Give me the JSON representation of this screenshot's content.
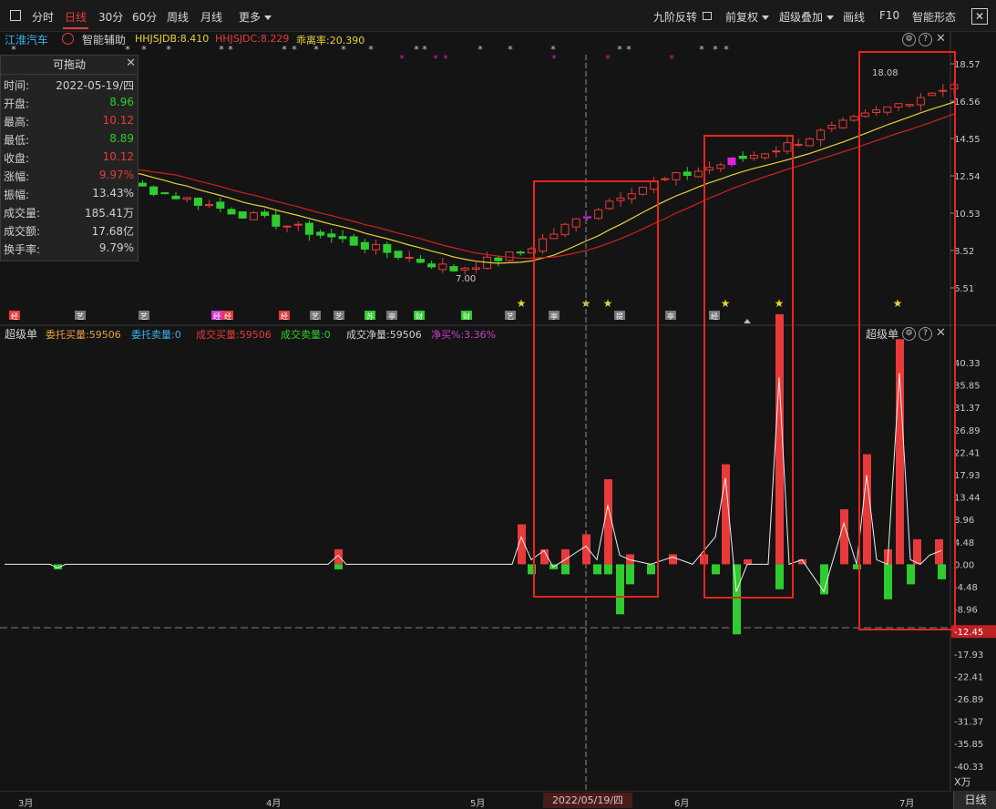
{
  "toolbar": {
    "items": [
      "分时",
      "日线",
      "30分",
      "60分",
      "周线",
      "月线",
      "更多"
    ],
    "right": [
      "九阶反转",
      "前复权",
      "超级叠加",
      "画线",
      "F10",
      "智能形态"
    ]
  },
  "info_line": {
    "stock": "江淮汽车",
    "assist": "智能辅助",
    "jdb": "HHJSJDB:8.410",
    "jdc": "HHJSJDC:8.229",
    "deviation": "乖离率:20.390"
  },
  "info_panel": {
    "title": "可拖动",
    "rows": [
      {
        "k": "时间:",
        "v": "2022-05-19/四",
        "c": "#d0d0d0"
      },
      {
        "k": "开盘:",
        "v": "8.96",
        "c": "#2ecc2e"
      },
      {
        "k": "最高:",
        "v": "10.12",
        "c": "#e83a3a"
      },
      {
        "k": "最低:",
        "v": "8.89",
        "c": "#2ecc2e"
      },
      {
        "k": "收盘:",
        "v": "10.12",
        "c": "#e83a3a"
      },
      {
        "k": "涨幅:",
        "v": "9.97%",
        "c": "#e83a3a"
      },
      {
        "k": "振幅:",
        "v": "13.43%",
        "c": "#d0d0d0"
      },
      {
        "k": "成交量:",
        "v": "185.41万",
        "c": "#d0d0d0"
      },
      {
        "k": "成交额:",
        "v": "17.68亿",
        "c": "#d0d0d0"
      },
      {
        "k": "换手率:",
        "v": "9.79%",
        "c": "#d0d0d0"
      }
    ]
  },
  "main_axis": [
    "18.57",
    "16.56",
    "14.55",
    "12.54",
    "10.53",
    "8.52",
    "6.51"
  ],
  "annotations": {
    "high": "18.08",
    "low": "7.00"
  },
  "sub_header": {
    "name": "超级单",
    "order_buy": "委托买量:59506",
    "order_sell": "委托卖量:0",
    "deal_buy": "成交买量:59506",
    "deal_sell": "成交卖量:0",
    "deal_net": "成交净量:59506",
    "net_pct": "净买%:3.36%",
    "right_name": "超级单"
  },
  "sub_axis": [
    "40.33",
    "35.85",
    "31.37",
    "26.89",
    "22.41",
    "17.93",
    "13.44",
    "8.96",
    "4.48",
    "0.00",
    "-4.48",
    "-8.96",
    "-12.45",
    "-17.93",
    "-22.41",
    "-26.89",
    "-31.37",
    "-35.85",
    "-40.33"
  ],
  "sub_unit": "X万",
  "bottom": {
    "months": [
      "3月",
      "4月",
      "5月",
      "6月",
      "7月"
    ],
    "selected": "2022/05/19/四",
    "period": "日线"
  },
  "event_tags": [
    "经",
    "艺",
    "艺",
    "经",
    "经",
    "经",
    "艺",
    "艺",
    "苏",
    "亭",
    "财",
    "财",
    "艺",
    "亭",
    "提",
    "亭",
    "经"
  ],
  "colors": {
    "up": "#e83a3a",
    "down": "#2ecc2e",
    "ma_yellow": "#e8d23a",
    "ma_red": "#d02020",
    "box": "#e8251e",
    "accent": "#e83a3a"
  }
}
